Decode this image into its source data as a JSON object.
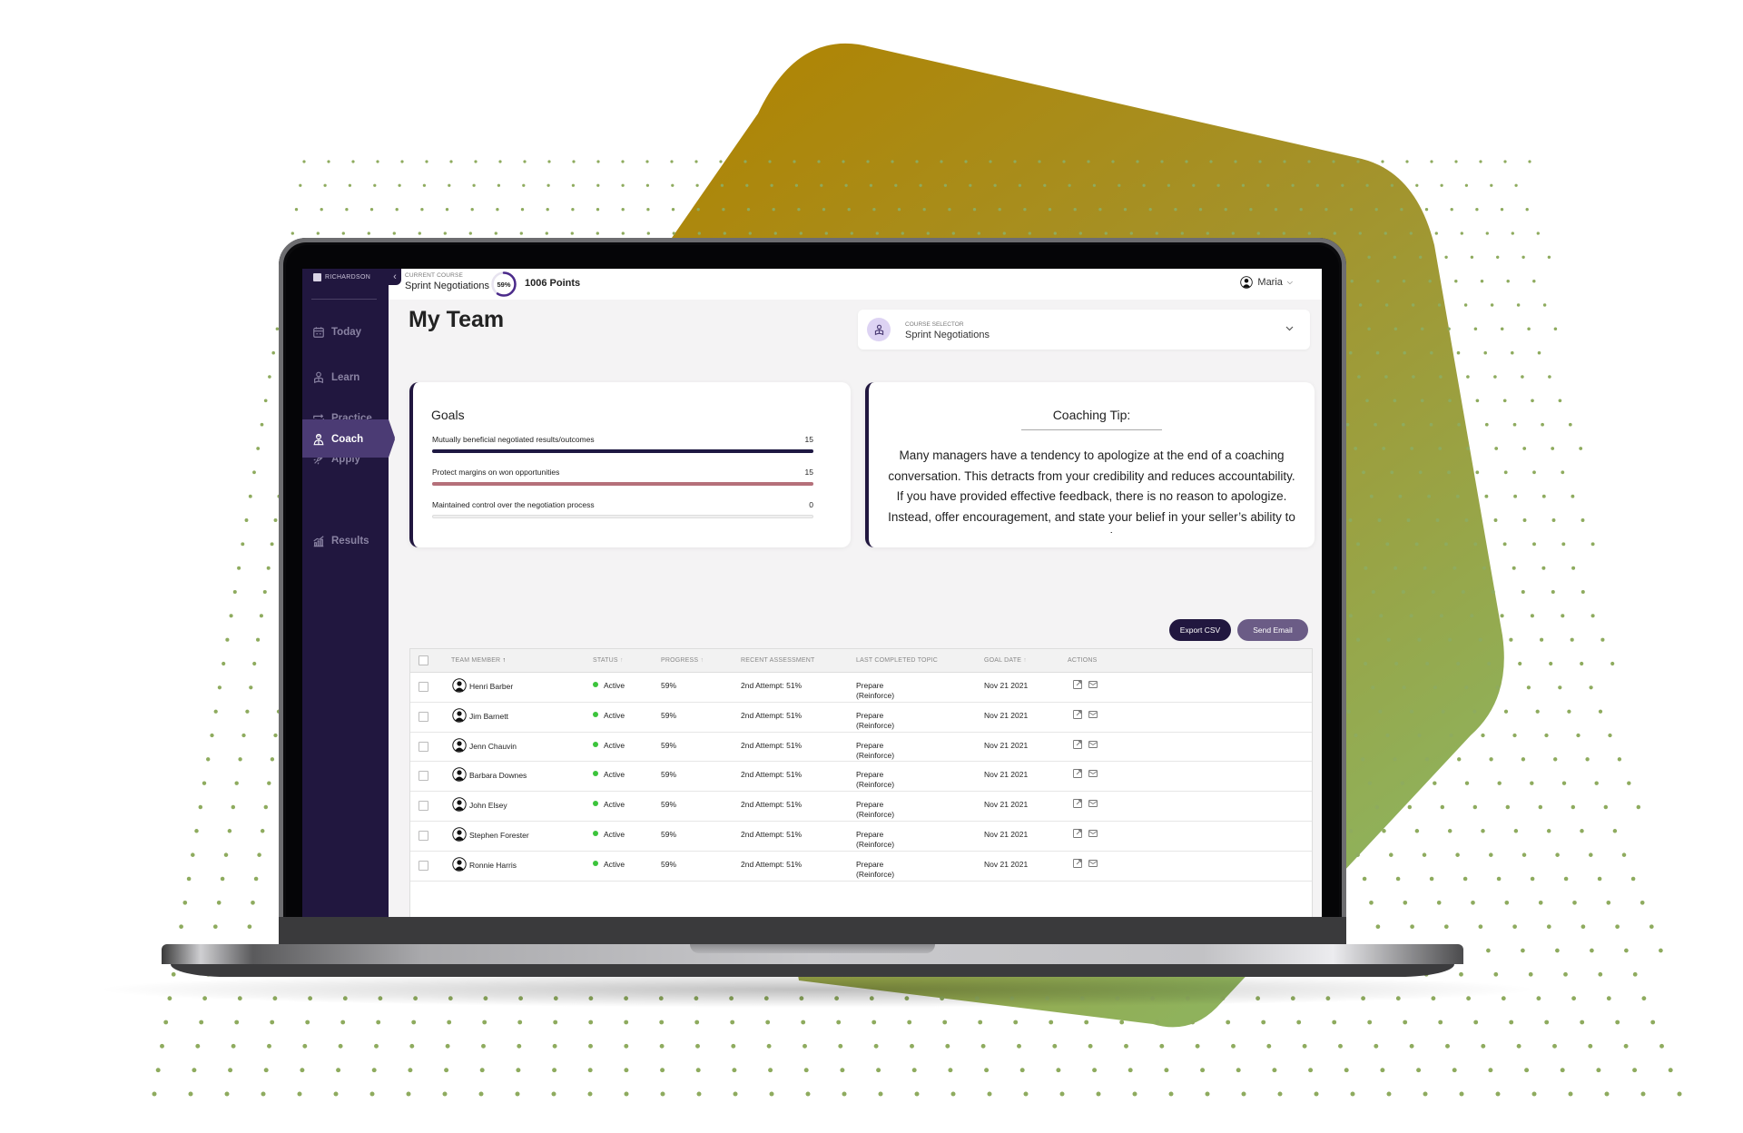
{
  "brand": {
    "logo_text": "RICHARDSON"
  },
  "colors": {
    "sidebar_bg": "#21173f",
    "accent_purple": "#4b3b74",
    "status_active": "#3cc43c",
    "goal_bar_1": "#1e1842",
    "goal_bar_2": "#b5707a",
    "shape_gold": "#b08500",
    "shape_green": "#8fb060"
  },
  "sidebar": {
    "collapse_icon": "chevron-left-icon",
    "items": [
      {
        "label": "Today",
        "icon": "calendar-icon",
        "active": false
      },
      {
        "label": "Learn",
        "icon": "learner-icon",
        "active": false
      },
      {
        "label": "Practice",
        "icon": "repeat-icon",
        "active": false
      },
      {
        "label": "Apply",
        "icon": "rocket-icon",
        "active": false
      },
      {
        "label": "Coach",
        "icon": "coach-icon",
        "active": true
      },
      {
        "label": "Results",
        "icon": "chart-icon",
        "active": false
      }
    ]
  },
  "topbar": {
    "current_course_label": "CURRENT COURSE",
    "current_course_value": "Sprint Negotiations",
    "progress_percent": 59,
    "progress_label": "59%",
    "points": "1006 Points",
    "user_name": "Maria"
  },
  "page": {
    "title": "My Team"
  },
  "course_selector": {
    "label": "COURSE SELECTOR",
    "value": "Sprint Negotiations"
  },
  "goals": {
    "title": "Goals",
    "items": [
      {
        "label": "Mutually beneficial negotiated results/outcomes",
        "value": "15",
        "fill_fraction": 1.0,
        "color": "#1e1842"
      },
      {
        "label": "Protect margins on won opportunities",
        "value": "15",
        "fill_fraction": 1.0,
        "color": "#b5707a"
      },
      {
        "label": "Maintained control over the negotiation process",
        "value": "0",
        "fill_fraction": 0.0,
        "color": "#cccccc"
      }
    ]
  },
  "coaching_tip": {
    "title": "Coaching Tip:",
    "body": "Many managers have a tendency to apologize at the end of a coaching conversation. This detracts from your credibility and reduces accountability. If you have provided effective feedback, there is no reason to apologize. Instead, offer encouragement, and state your belief in your seller’s ability to succeed."
  },
  "actions": {
    "export_csv": "Export CSV",
    "send_email": "Send Email"
  },
  "table": {
    "columns": [
      {
        "label": "TEAM MEMBER",
        "sort": "↑"
      },
      {
        "label": "STATUS",
        "sort": "↑"
      },
      {
        "label": "PROGRESS",
        "sort": "↑"
      },
      {
        "label": "RECENT ASSESSMENT",
        "sort": ""
      },
      {
        "label": "LAST COMPLETED TOPIC",
        "sort": ""
      },
      {
        "label": "GOAL DATE",
        "sort": "↑"
      },
      {
        "label": "ACTIONS",
        "sort": ""
      }
    ],
    "rows": [
      {
        "name": "Henri Barber",
        "status": "Active",
        "progress": "59%",
        "assessment": "2nd Attempt: 51%",
        "topic": "Prepare",
        "topic_sub": "(Reinforce)",
        "goal_date": "Nov 21 2021"
      },
      {
        "name": "Jim Barnett",
        "status": "Active",
        "progress": "59%",
        "assessment": "2nd Attempt: 51%",
        "topic": "Prepare",
        "topic_sub": "(Reinforce)",
        "goal_date": "Nov 21 2021"
      },
      {
        "name": "Jenn Chauvin",
        "status": "Active",
        "progress": "59%",
        "assessment": "2nd Attempt: 51%",
        "topic": "Prepare",
        "topic_sub": "(Reinforce)",
        "goal_date": "Nov 21 2021"
      },
      {
        "name": "Barbara Downes",
        "status": "Active",
        "progress": "59%",
        "assessment": "2nd Attempt: 51%",
        "topic": "Prepare",
        "topic_sub": "(Reinforce)",
        "goal_date": "Nov 21 2021"
      },
      {
        "name": "John Elsey",
        "status": "Active",
        "progress": "59%",
        "assessment": "2nd Attempt: 51%",
        "topic": "Prepare",
        "topic_sub": "(Reinforce)",
        "goal_date": "Nov 21 2021"
      },
      {
        "name": "Stephen Forester",
        "status": "Active",
        "progress": "59%",
        "assessment": "2nd Attempt: 51%",
        "topic": "Prepare",
        "topic_sub": "(Reinforce)",
        "goal_date": "Nov 21 2021"
      },
      {
        "name": "Ronnie Harris",
        "status": "Active",
        "progress": "59%",
        "assessment": "2nd Attempt: 51%",
        "topic": "Prepare",
        "topic_sub": "(Reinforce)",
        "goal_date": "Nov 21 2021"
      }
    ]
  }
}
